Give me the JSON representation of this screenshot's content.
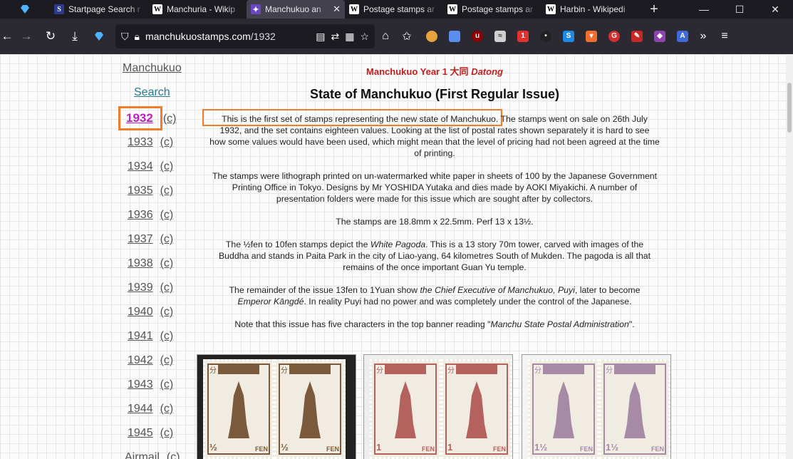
{
  "browser": {
    "tabs": [
      {
        "title": "Startpage Search r",
        "favicon": "S",
        "active": false
      },
      {
        "title": "Manchuria - Wikip",
        "favicon": "W",
        "active": false
      },
      {
        "title": "Manchukuo an",
        "favicon": "✦",
        "active": true
      },
      {
        "title": "Postage stamps ar",
        "favicon": "W",
        "active": false
      },
      {
        "title": "Postage stamps ar",
        "favicon": "W",
        "active": false
      },
      {
        "title": "Harbin - Wikipedi",
        "favicon": "W",
        "active": false
      }
    ],
    "url_domain": "manchukuostamps.com",
    "url_path": "/1932",
    "colors": {
      "tabbar": "#1c1b22",
      "toolbar": "#2b2a33"
    }
  },
  "sidebar": {
    "home_link": "Manchukuo",
    "search_link": "Search",
    "years": [
      {
        "year": "1932",
        "c": "(c)",
        "current": true
      },
      {
        "year": "1933",
        "c": "(c)"
      },
      {
        "year": "1934",
        "c": "(c)"
      },
      {
        "year": "1935",
        "c": "(c)"
      },
      {
        "year": "1936",
        "c": "(c)"
      },
      {
        "year": "1937",
        "c": "(c)"
      },
      {
        "year": "1938",
        "c": "(c)"
      },
      {
        "year": "1939",
        "c": "(c)"
      },
      {
        "year": "1940",
        "c": "(c)"
      },
      {
        "year": "1941",
        "c": "(c)"
      },
      {
        "year": "1942",
        "c": "(c)"
      },
      {
        "year": "1943",
        "c": "(c)"
      },
      {
        "year": "1944",
        "c": "(c)"
      },
      {
        "year": "1945",
        "c": "(c)"
      },
      {
        "year": "Airmail",
        "c": "(c)"
      }
    ]
  },
  "main": {
    "year_heading": "Manchukuo Year 1 大同",
    "year_heading_era": "Datong",
    "title": "State of Manchukuo (First Regular Issue)",
    "intro_highlight": "This is the first set of stamps representing the new state of Manchukuo.",
    "intro_line1_rest": "The stamps went on sale on 26th July",
    "intro_line2": "1932, and the set contains eighteen values. Looking at the list of postal rates shown separately it is hard to see",
    "intro_line3": "how some values would have been used, which might mean that the level of pricing had not been agreed at the time",
    "intro_line4": "of printing.",
    "p2_line1": "The stamps were lithograph printed on un-watermarked white paper in sheets of 100 by the Japanese Government",
    "p2_line2": "Printing Office in Tokyo. Designs by Mr YOSHIDA Yutaka and dies made by AOKI Miyakichi. A number of",
    "p2_line3": "presentation folders were made for this issue which are sought after by collectors.",
    "p3": "The stamps are 18.8mm x 22.5mm. Perf 13 x 13½.",
    "p4_line1_a": "The ½fen to 10fen stamps depict the",
    "p4_line1_i": "White Pagoda",
    "p4_line1_b": ". This is a 13 story 70m tower, carved with images of the",
    "p4_line2": "Buddha and stands in Paita Park in the city of Liao-yang, 64 kilometres South of Mukden. The pagoda is all that",
    "p4_line3": "remains of the once important Guan Yu temple.",
    "p5_line1_a": "The remainder of the issue 13fen to 1Yuan show",
    "p5_line1_i": "the Chief Executive of Manchukuo, Puyi",
    "p5_line1_b": ", later to become",
    "p5_line2_i": "Emperor Kāngdé",
    "p5_line2_b": ". In reality Puyi had no power and was completely under the control of the Japanese.",
    "p6_a": "Note that this issue has five characters in the top banner reading \"",
    "p6_i": "Manchu State Postal Administration",
    "p6_b": "\".",
    "colors": {
      "year_heading": "#c41e1e",
      "current_year": "#c020c0",
      "highlight": "#ee7e2b"
    }
  },
  "stamps": [
    {
      "value": "½",
      "unit": "FEN",
      "color": "#7a5a3a",
      "side": "分"
    },
    {
      "value": "1",
      "unit": "FEN",
      "color": "#b5615e",
      "side": "分"
    },
    {
      "value": "1½",
      "unit": "FEN",
      "color": "#a78aa6",
      "side": "分"
    }
  ]
}
